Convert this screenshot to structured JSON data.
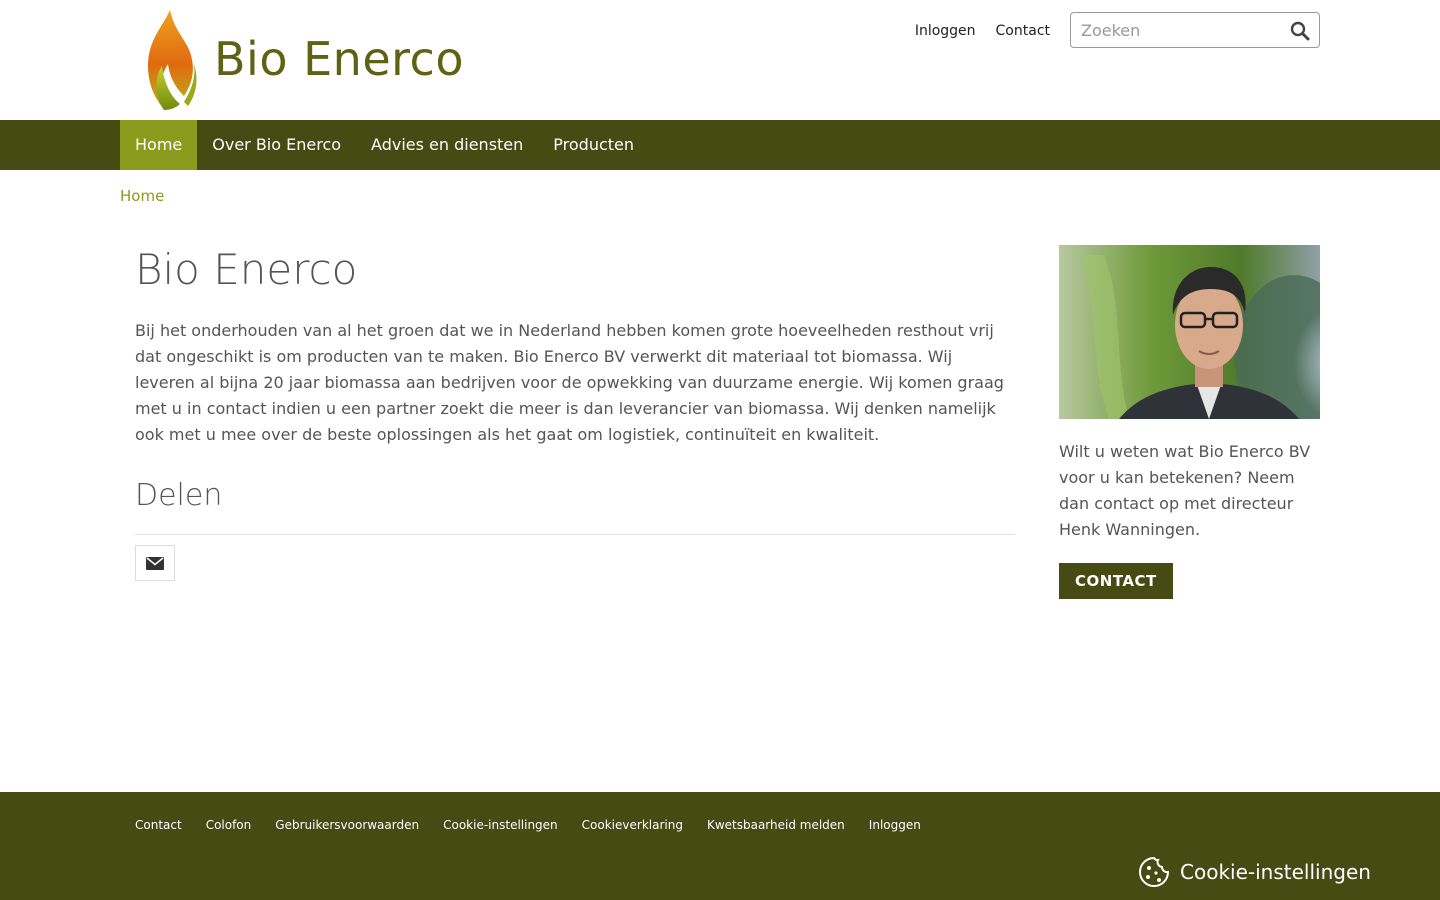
{
  "header": {
    "brand": "Bio Enerco",
    "top_links": [
      "Inloggen",
      "Contact"
    ],
    "search_placeholder": "Zoeken"
  },
  "nav": {
    "items": [
      "Home",
      "Over Bio Enerco",
      "Advies en diensten",
      "Producten"
    ],
    "active": "Home"
  },
  "breadcrumb": "Home",
  "main": {
    "title": "Bio Enerco",
    "intro": "Bij het onderhouden van al het groen dat we in Nederland hebben komen grote hoeveelheden resthout vrij dat ongeschikt is om producten van te maken. Bio Enerco BV verwerkt dit materiaal tot biomassa. Wij leveren al bijna 20 jaar biomassa aan bedrijven voor de opwekking van duurzame energie. Wij komen graag met u in contact indien u een partner zoekt die meer is dan leverancier van biomassa. Wij denken namelijk ook met u mee over de beste oplossingen als het gaat om logistiek, continuïteit en kwaliteit.",
    "share_title": "Delen"
  },
  "sidebar": {
    "text": "Wilt u weten wat Bio Enerco BV voor u kan betekenen? Neem dan contact op met directeur Henk Wanningen.",
    "button": "CONTACT"
  },
  "footer": {
    "links": [
      "Contact",
      "Colofon",
      "Gebruikersvoorwaarden",
      "Cookie-instellingen",
      "Cookieverklaring",
      "Kwetsbaarheid melden",
      "Inloggen"
    ],
    "cookie_label": "Cookie-instellingen"
  },
  "colors": {
    "brand_dark": "#454b13",
    "brand_active": "#8b9b1e",
    "brand_text": "#5c6314"
  }
}
